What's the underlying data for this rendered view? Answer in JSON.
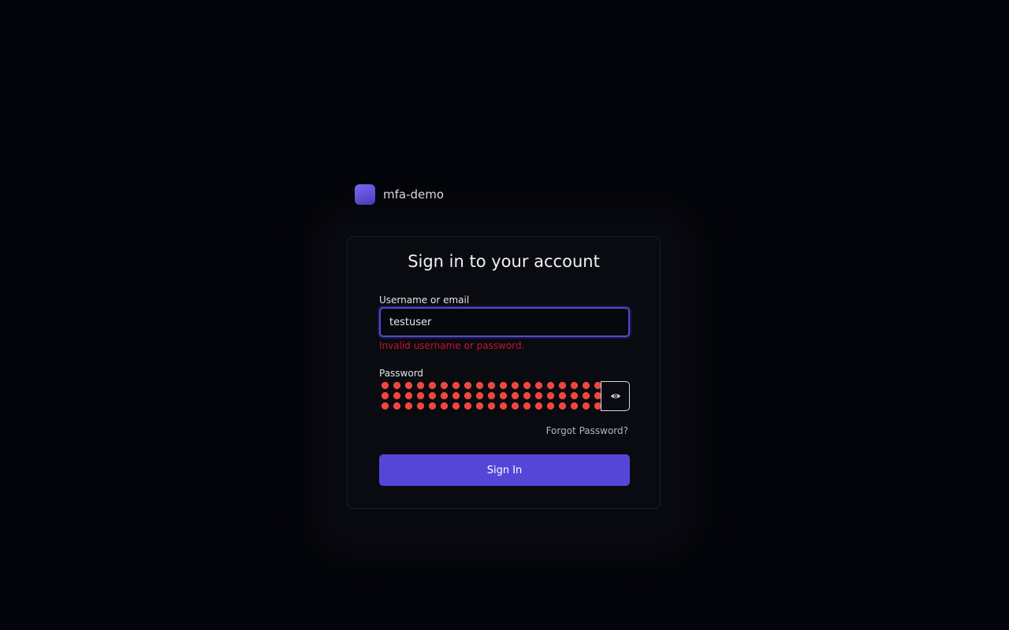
{
  "brand": {
    "name": "mfa-demo",
    "logo_color": "#6a5be8"
  },
  "card": {
    "title": "Sign in to your account"
  },
  "username": {
    "label": "Username or email",
    "value": "testuser",
    "error": "Invalid username or password."
  },
  "password": {
    "label": "Password",
    "toggle_icon": "eye-icon"
  },
  "links": {
    "forgot_password": "Forgot Password?"
  },
  "actions": {
    "sign_in_label": "Sign In"
  },
  "colors": {
    "background": "#04050a",
    "card": "#090b10",
    "accent": "#5646d8",
    "error": "#c8102e",
    "password_fill": "#f0463c"
  }
}
